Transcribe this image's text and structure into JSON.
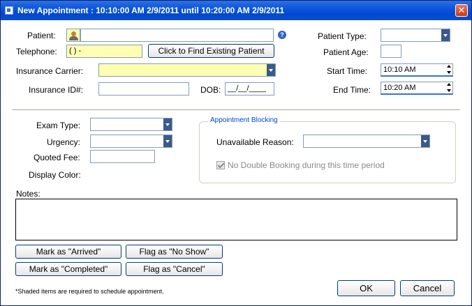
{
  "window": {
    "title": "New Appointment : 10:10:00 AM 2/9/2011  until  10:20:00 AM 2/9/2011",
    "close_glyph": "✕"
  },
  "patient": {
    "label": "Patient:",
    "value": ""
  },
  "help_glyph": "?",
  "telephone": {
    "label": "Telephone:",
    "value": "(    )      -"
  },
  "find_patient_button": "Click to Find Existing Patient",
  "insurance_carrier": {
    "label": "Insurance Carrier:",
    "value": ""
  },
  "insurance_id": {
    "label": "Insurance ID#:",
    "value": ""
  },
  "dob": {
    "label": "DOB:",
    "value": "__/__/____"
  },
  "patient_type": {
    "label": "Patient Type:",
    "value": ""
  },
  "patient_age": {
    "label": "Patient Age:",
    "value": ""
  },
  "start_time": {
    "label": "Start Time:",
    "value": "10:10 AM"
  },
  "end_time": {
    "label": "End Time:",
    "value": "10:20 AM"
  },
  "exam_type": {
    "label": "Exam Type:",
    "value": ""
  },
  "urgency": {
    "label": "Urgency:",
    "value": ""
  },
  "quoted_fee": {
    "label": "Quoted Fee:",
    "value": ""
  },
  "display_color": {
    "label": "Display Color:"
  },
  "appointment_blocking": {
    "title": "Appointment Blocking",
    "unavailable_reason_label": "Unavailable Reason:",
    "unavailable_reason_value": "",
    "no_double_booking_label": "No Double Booking during this time period",
    "no_double_booking_checked": true
  },
  "notes": {
    "label": "Notes:",
    "value": ""
  },
  "buttons": {
    "arrived": "Mark as \"Arrived\"",
    "no_show": "Flag as \"No Show\"",
    "completed": "Mark as \"Completed\"",
    "cancel_flag": "Flag as \"Cancel\"",
    "ok": "OK",
    "cancel": "Cancel"
  },
  "footnote": "*Shaded items are required to schedule appointment.",
  "colors": {
    "required_field": "#ffffb3",
    "title_bar": "#0a56dd",
    "group_title": "#0046d5"
  }
}
